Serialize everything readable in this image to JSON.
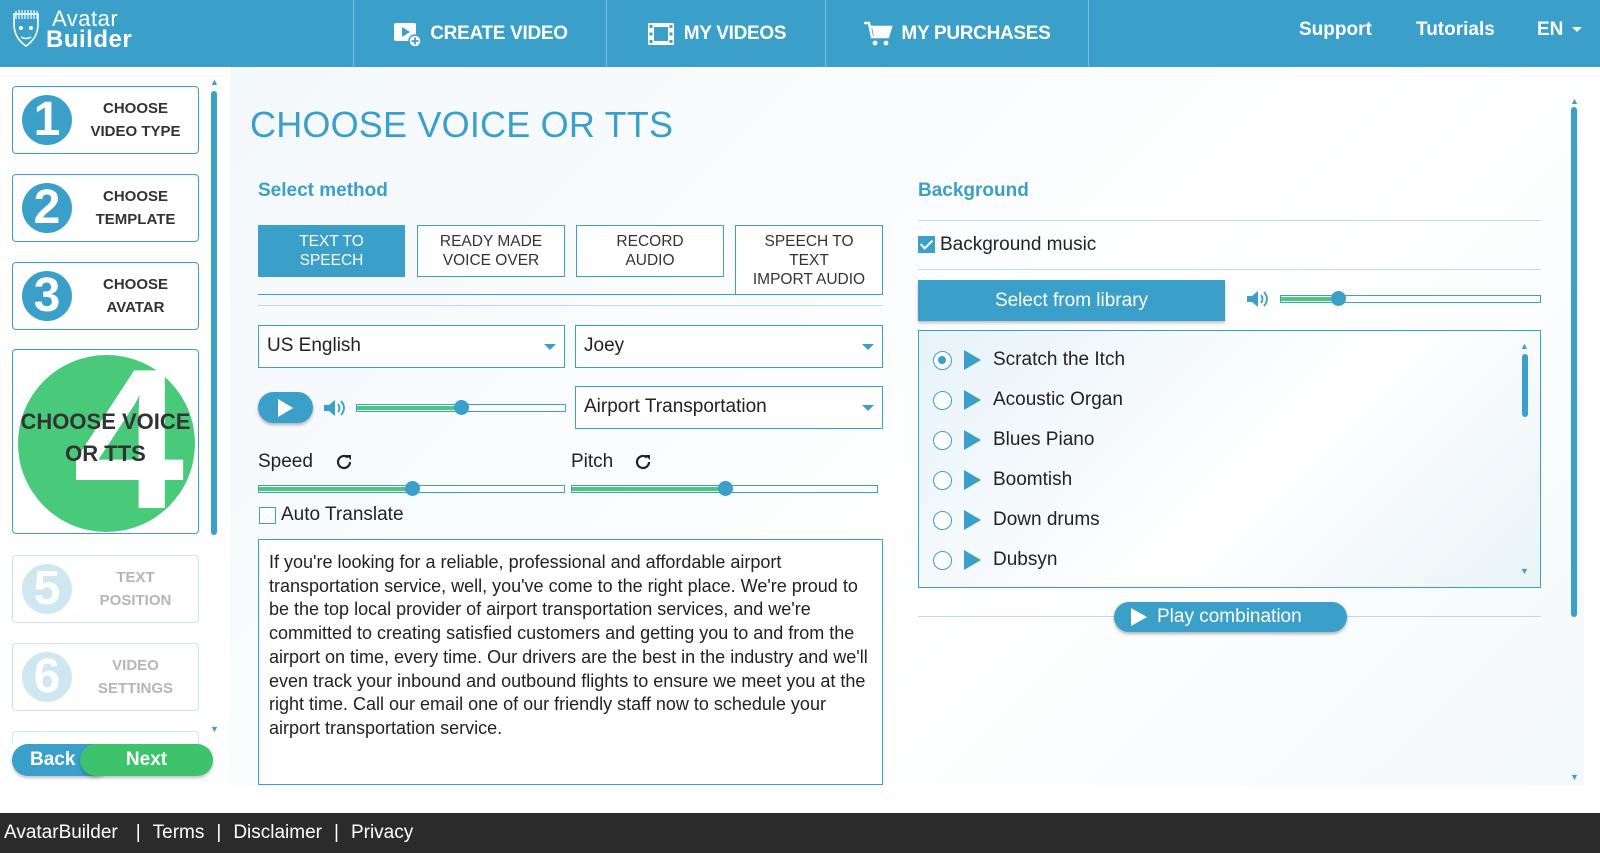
{
  "brand": {
    "line1": "Avatar",
    "line2": "Builder"
  },
  "nav": {
    "create_video": "CREATE VIDEO",
    "my_videos": "MY VIDEOS",
    "my_purchases": "MY PURCHASES",
    "support": "Support",
    "tutorials": "Tutorials",
    "language": "EN"
  },
  "steps": [
    {
      "num": "1",
      "label_line1": "CHOOSE",
      "label_line2": "VIDEO TYPE",
      "state": "done"
    },
    {
      "num": "2",
      "label_line1": "CHOOSE",
      "label_line2": "TEMPLATE",
      "state": "done"
    },
    {
      "num": "3",
      "label_line1": "CHOOSE",
      "label_line2": "AVATAR",
      "state": "done"
    },
    {
      "num": "4",
      "label_line1": "CHOOSE VOICE",
      "label_line2": "OR TTS",
      "state": "active"
    },
    {
      "num": "5",
      "label_line1": "TEXT",
      "label_line2": "POSITION",
      "state": "disabled"
    },
    {
      "num": "6",
      "label_line1": "VIDEO",
      "label_line2": "SETTINGS",
      "state": "disabled"
    }
  ],
  "buttons": {
    "back": "Back",
    "next": "Next"
  },
  "page_title": "CHOOSE VOICE OR TTS",
  "method": {
    "label": "Select method",
    "tabs": [
      {
        "line1": "TEXT TO",
        "line2": "SPEECH",
        "line3": "",
        "active": true
      },
      {
        "line1": "READY MADE",
        "line2": "VOICE OVER",
        "line3": "",
        "active": false
      },
      {
        "line1": "RECORD",
        "line2": "AUDIO",
        "line3": "",
        "active": false
      },
      {
        "line1": "SPEECH TO",
        "line2": "TEXT",
        "line3": "IMPORT AUDIO",
        "active": false
      }
    ]
  },
  "tts": {
    "language": "US English",
    "voice": "Joey",
    "script_name": "Airport Transportation",
    "volume": 0.5,
    "speed_label": "Speed",
    "speed": 0.5,
    "pitch_label": "Pitch",
    "pitch": 0.5,
    "auto_translate_label": "Auto Translate",
    "auto_translate": false,
    "text": "If you're looking for a reliable, professional and affordable airport transportation service, well, you've come to the right place. We're proud to be the top local provider of airport transportation services, and we're committed to creating satisfied customers and getting you to and from the airport on time, every time. Our drivers are the best in the industry and we'll even track your inbound and outbound flights to ensure we meet you at the right time. Call our email one of our friendly staff now to schedule your airport transportation service."
  },
  "background": {
    "label": "Background",
    "music_label": "Background music",
    "music_enabled": true,
    "library_button": "Select from library",
    "volume": 0.22,
    "tracks": [
      {
        "name": "Scratch the Itch",
        "selected": true
      },
      {
        "name": "Acoustic Organ",
        "selected": false
      },
      {
        "name": "Blues Piano",
        "selected": false
      },
      {
        "name": "Boomtish",
        "selected": false
      },
      {
        "name": "Down drums",
        "selected": false
      },
      {
        "name": "Dubsyn",
        "selected": false
      }
    ],
    "play_combination": "Play combination"
  },
  "footer": {
    "brand": "AvatarBuilder",
    "terms": "Terms",
    "disclaimer": "Disclaimer",
    "privacy": "Privacy"
  },
  "colors": {
    "primary": "#3a9fc9",
    "accent_green": "#49c97a",
    "footer_bg": "#2b2b2b"
  }
}
